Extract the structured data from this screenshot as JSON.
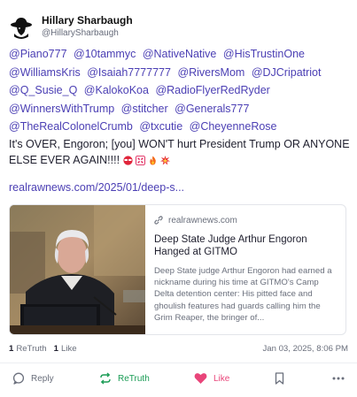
{
  "author": {
    "display_name": "Hillary Sharbaugh",
    "handle": "@HillarySharbaugh",
    "avatar_icon": "hat-silhouette-avatar"
  },
  "mentions": [
    "@Piano777",
    "@10tammyc",
    "@NativeNative",
    "@HisTrustinOne",
    "@WilliamsKris",
    "@Isaiah7777777",
    "@RiversMom",
    "@DJCripatriot",
    "@Q_Susie_Q",
    "@KalokoKoa",
    "@RadioFlyerRedRyder",
    "@WinnersWithTrump",
    "@stitcher",
    "@Generals777",
    "@TheRealColonelCrumb",
    "@txcutie",
    "@CheyenneRose"
  ],
  "body_text": "It's OVER, Engoron; [you] WON'T hurt President Trump OR ANYONE ELSE EVER AGAIN!!!!",
  "body_emojis": [
    "sunglasses-red-icon",
    "anger-symbol-icon",
    "fire-icon",
    "collision-icon"
  ],
  "link_text": "realrawnews.com/2025/01/deep-s...",
  "card": {
    "domain": "realrawnews.com",
    "title": "Deep State Judge Arthur Engoron Hanged at GITMO",
    "description": "Deep State judge Arthur Engoron had earned a nickname during his time at GITMO's Camp Delta detention center: His pitted face and ghoulish features had guards calling him the Grim Reaper, the bringer of..."
  },
  "meta": {
    "retruth_count": "1",
    "retruth_label": "ReTruth",
    "like_count": "1",
    "like_label": "Like",
    "timestamp": "Jan 03, 2025, 8:06 PM"
  },
  "actions": {
    "reply": "Reply",
    "retruth": "ReTruth",
    "like": "Like"
  },
  "colors": {
    "mention": "#4b3fb4",
    "retruth_active": "#1a9c55",
    "like_active": "#e9457a",
    "muted": "#6a6f7c"
  }
}
